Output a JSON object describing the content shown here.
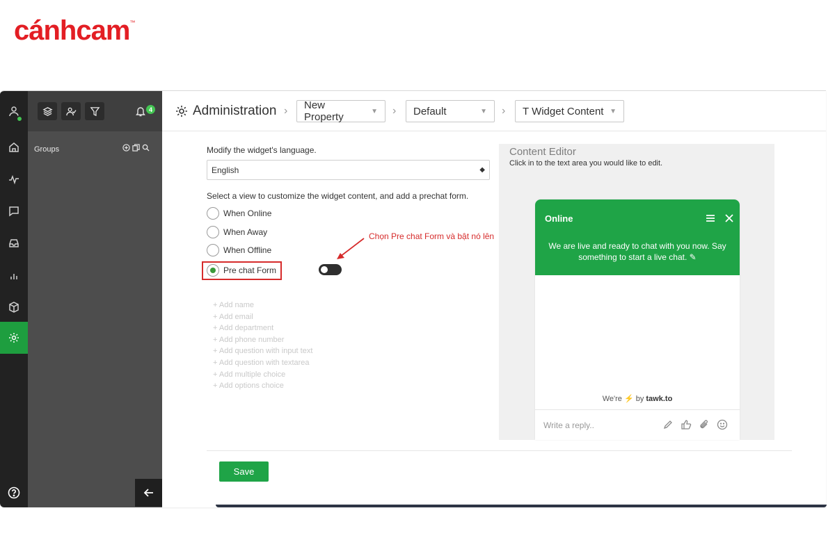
{
  "brand": {
    "logo_text": "cánhcam",
    "trademark": "™"
  },
  "colors": {
    "accent": "#1fa447",
    "sidebar": "#222222",
    "panel": "#4d4d4d",
    "annotation": "#d62b2b",
    "brand": "#e31e24"
  },
  "rail": {
    "items": [
      {
        "icon": "user-status-icon"
      },
      {
        "icon": "home-icon"
      },
      {
        "icon": "activity-icon"
      },
      {
        "icon": "chat-icon"
      },
      {
        "icon": "inbox-icon"
      },
      {
        "icon": "reports-icon"
      },
      {
        "icon": "addons-icon"
      },
      {
        "icon": "settings-icon",
        "active": true
      }
    ],
    "help_icon": "help-icon"
  },
  "panel": {
    "notifications_count": "4",
    "groups_label": "Groups"
  },
  "header": {
    "title": "Administration",
    "property": "New Property",
    "widget": "Default",
    "section": "Widget Content"
  },
  "form": {
    "language_label": "Modify the widget's language.",
    "language_value": "English",
    "view_label": "Select a view to customize the widget content, and add a prechat form.",
    "views": [
      {
        "label": "When Online",
        "checked": false
      },
      {
        "label": "When Away",
        "checked": false
      },
      {
        "label": "When Offline",
        "checked": false
      },
      {
        "label": "Pre chat Form",
        "checked": true
      }
    ],
    "prechat_enabled": false,
    "fields": [
      "+ Add name",
      "+ Add email",
      "+ Add department",
      "+ Add phone number",
      "+ Add question with input text",
      "+ Add question with textarea",
      "+ Add multiple choice",
      "+ Add options choice"
    ],
    "annotation": "Chọn Pre chat Form và bật nó lên",
    "save_label": "Save"
  },
  "editor": {
    "title": "Content Editor",
    "subtitle": "Click in to the text area you would like to edit.",
    "chat": {
      "status": "Online",
      "message": "We are live and ready to chat with you now. Say something to start a live chat.",
      "powered_prefix": "We're",
      "powered_suffix": "by",
      "powered_brand": "tawk.to",
      "input_placeholder": "Write a reply.."
    }
  }
}
